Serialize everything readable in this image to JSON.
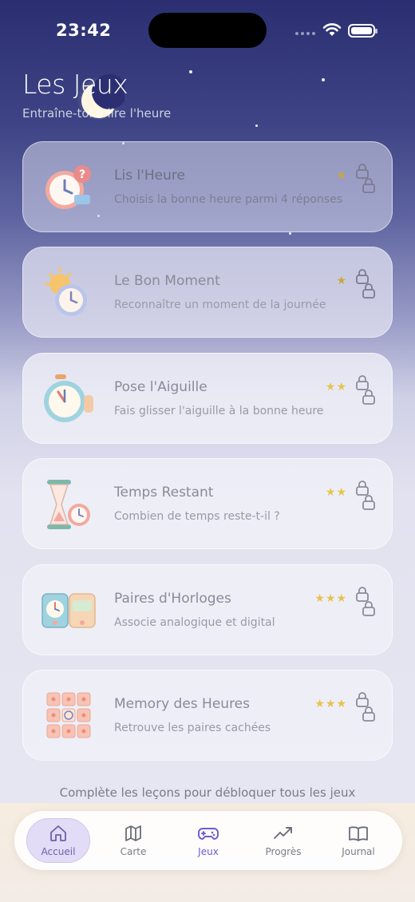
{
  "status_bar": {
    "time": "23:42"
  },
  "header": {
    "title": "Les Jeux",
    "subtitle": "Entraîne-toi à lire l'heure"
  },
  "games": [
    {
      "title": "Lis l'Heure",
      "description": "Choisis la bonne heure parmi 4 réponses",
      "stars": "★",
      "difficulty": 1,
      "locked": true,
      "icon": "clock-question-icon"
    },
    {
      "title": "Le Bon Moment",
      "description": "Reconnaître un moment de la journée",
      "stars": "★",
      "difficulty": 1,
      "locked": true,
      "icon": "sun-moon-clock-icon"
    },
    {
      "title": "Pose l'Aiguille",
      "description": "Fais glisser l'aiguille à la bonne heure",
      "stars": "★★",
      "difficulty": 2,
      "locked": true,
      "icon": "alarm-clock-hand-icon"
    },
    {
      "title": "Temps Restant",
      "description": "Combien de temps reste-t-il ?",
      "stars": "★★",
      "difficulty": 2,
      "locked": true,
      "icon": "hourglass-clock-icon"
    },
    {
      "title": "Paires d'Horloges",
      "description": "Associe analogique et digital",
      "stars": "★★★",
      "difficulty": 3,
      "locked": true,
      "icon": "analog-digital-pair-icon"
    },
    {
      "title": "Memory des Heures",
      "description": "Retrouve les paires cachées",
      "stars": "★★★",
      "difficulty": 3,
      "locked": true,
      "icon": "memory-grid-icon"
    }
  ],
  "footer_note": "Complète les leçons pour débloquer tous les jeux",
  "tab_bar": {
    "tabs": [
      {
        "label": "Accueil",
        "icon": "home-icon"
      },
      {
        "label": "Carte",
        "icon": "map-icon"
      },
      {
        "label": "Jeux",
        "icon": "gamepad-icon"
      },
      {
        "label": "Progrès",
        "icon": "trend-up-icon"
      },
      {
        "label": "Journal",
        "icon": "book-icon"
      }
    ]
  },
  "colors": {
    "accent": "#6a5ccf",
    "star": "#e6c34a",
    "night_sky": "#2b2f72"
  }
}
